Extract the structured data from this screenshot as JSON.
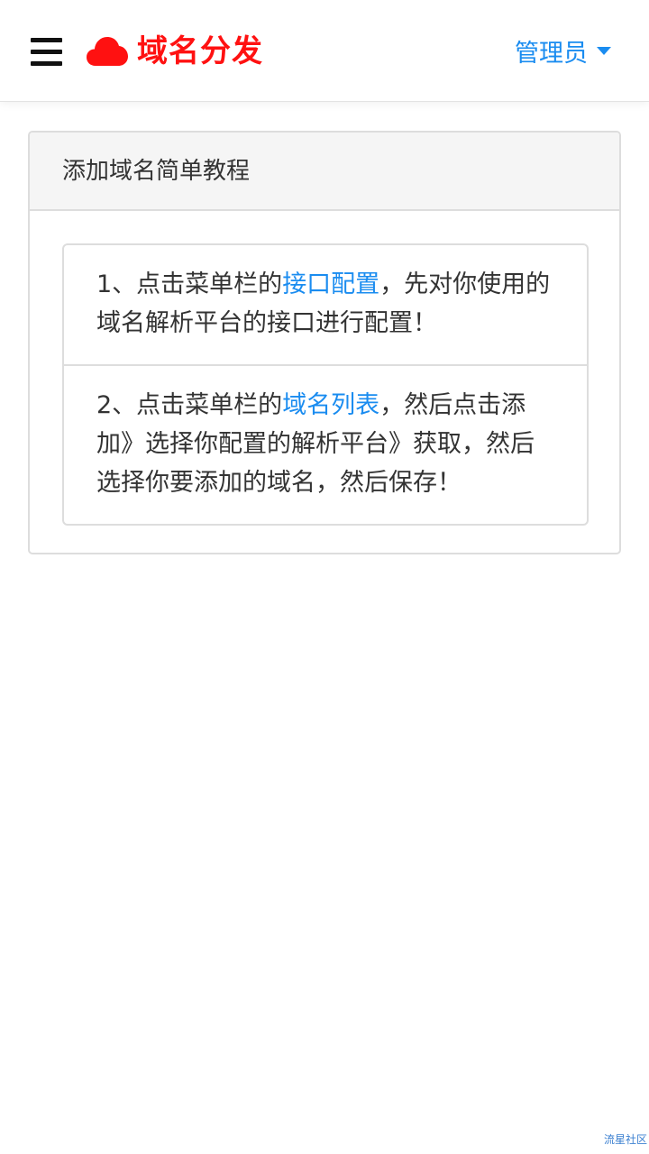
{
  "header": {
    "brand_name": "域名分发",
    "user_label": "管理员",
    "brand_color": "#ff1111",
    "link_color": "#1a8cf0",
    "icons": [
      "menu-icon",
      "cloud-icon",
      "caret-down-icon"
    ]
  },
  "tutorial": {
    "title": "添加域名简单教程",
    "items": [
      {
        "prefix": "1、点击菜单栏的",
        "link": "接口配置",
        "suffix": "，先对你使用的域名解析平台的接口进行配置！"
      },
      {
        "prefix": "2、点击菜单栏的",
        "link": "域名列表",
        "suffix": "，然后点击添加》选择你配置的解析平台》获取，然后选择你要添加的域名，然后保存！"
      }
    ]
  },
  "watermark": "流星社区"
}
